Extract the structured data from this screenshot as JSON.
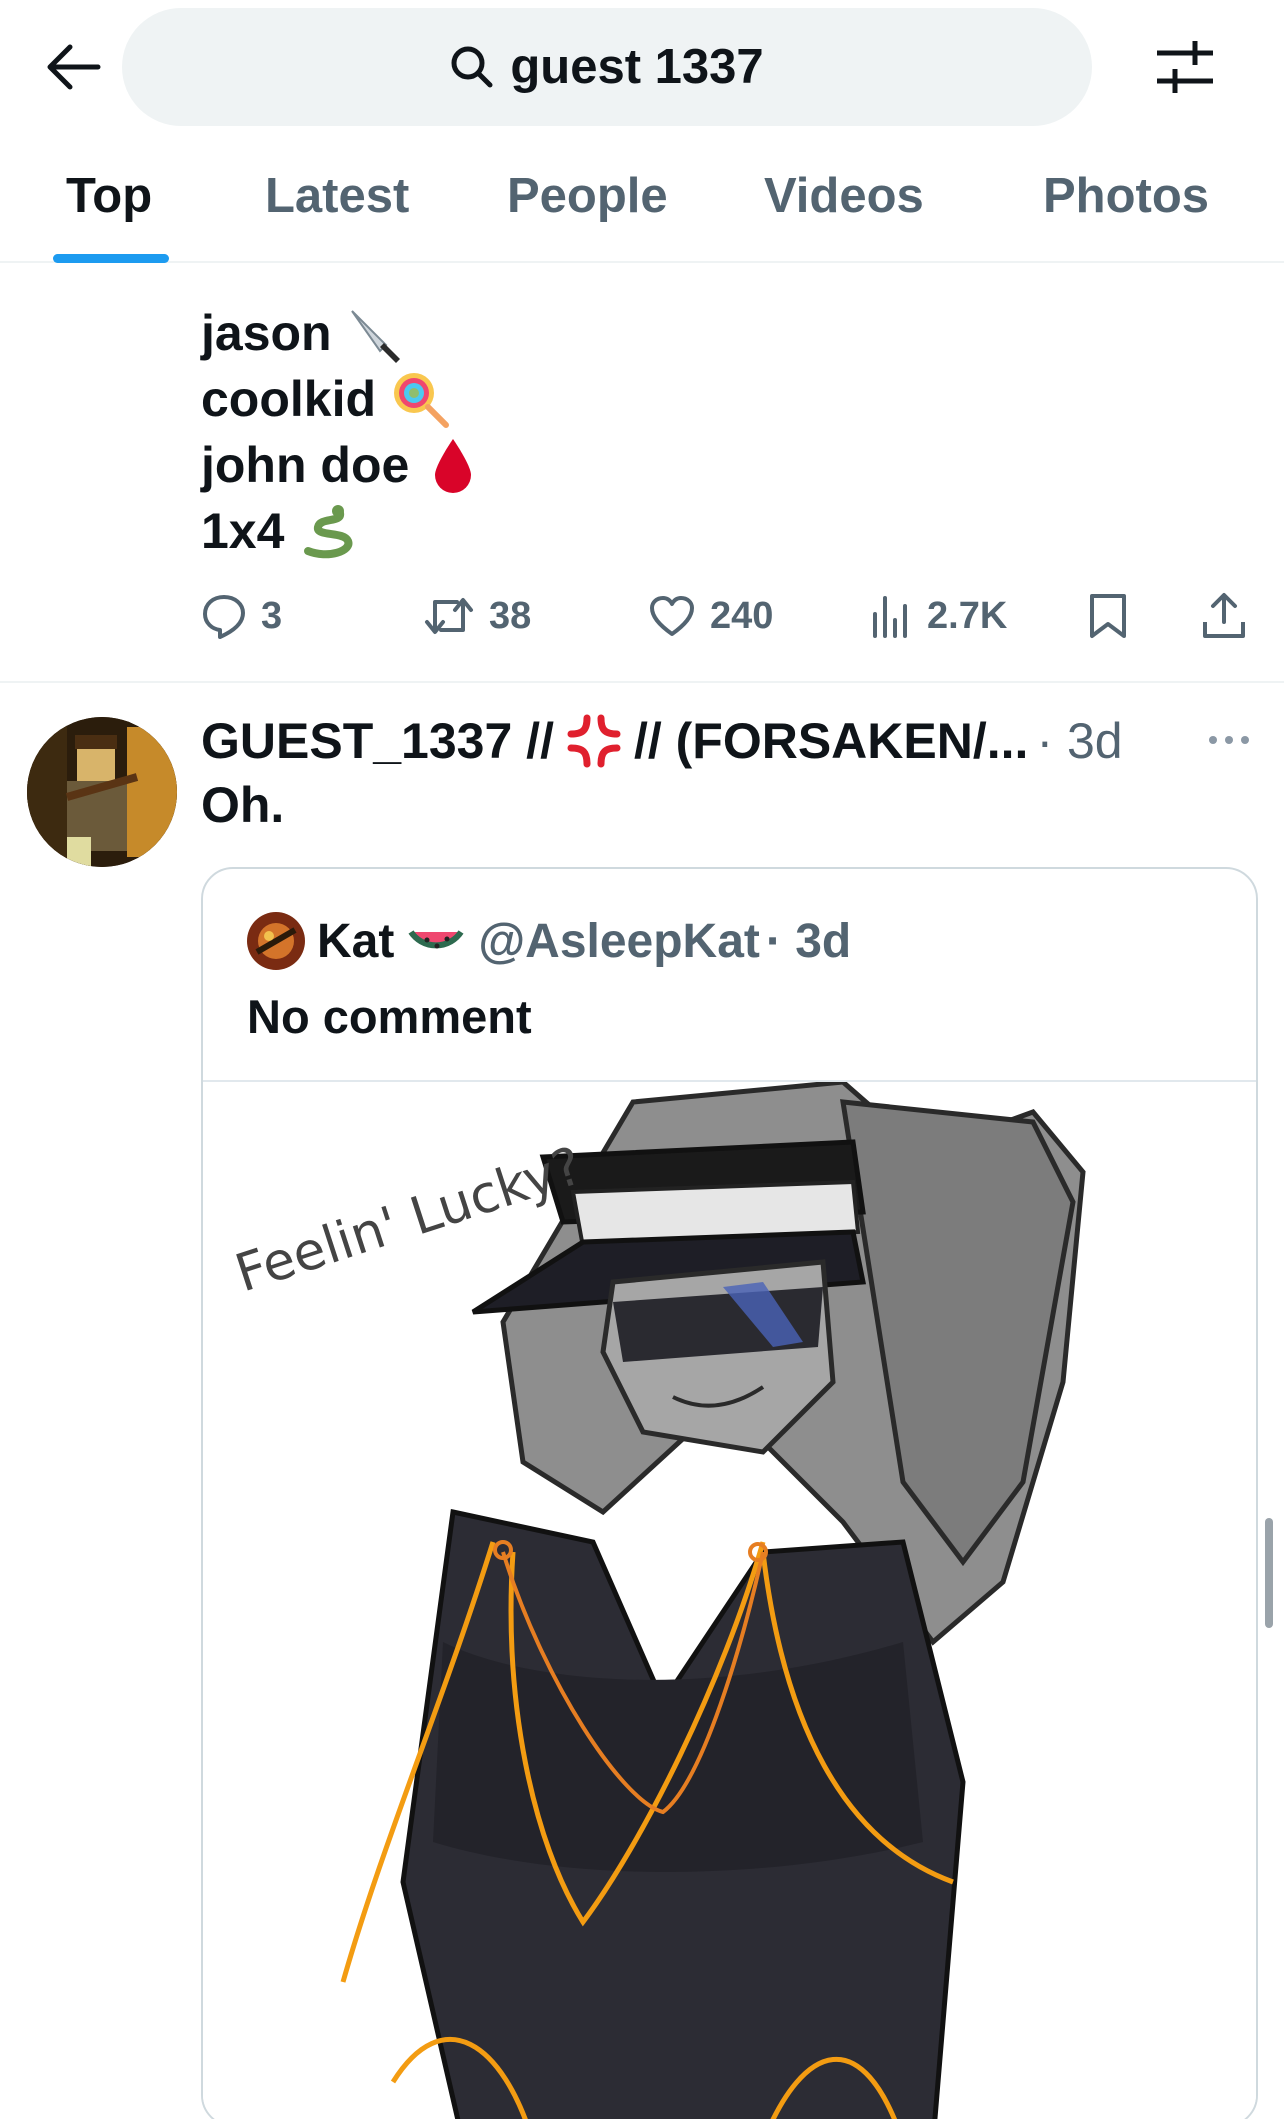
{
  "search": {
    "query": "guest 1337"
  },
  "icons": {
    "back": "arrow-left-icon",
    "search": "search-icon",
    "filter": "sliders-icon",
    "reply": "reply-icon",
    "retweet": "retweet-icon",
    "like": "heart-icon",
    "views": "views-icon",
    "bookmark": "bookmark-icon",
    "share": "share-icon",
    "more": "more-icon"
  },
  "tabs": [
    {
      "label": "Top",
      "active": true
    },
    {
      "label": "Latest"
    },
    {
      "label": "People"
    },
    {
      "label": "Videos"
    },
    {
      "label": "Photos"
    }
  ],
  "tweet1": {
    "lines": [
      {
        "text": "jason",
        "emoji": "knife"
      },
      {
        "text": "coolkid",
        "emoji": "lollipop"
      },
      {
        "text": "john doe",
        "emoji": "drop-of-blood"
      },
      {
        "text": "1x4",
        "emoji": "snake"
      }
    ],
    "stats": {
      "replies": "3",
      "retweets": "38",
      "likes": "240",
      "views": "2.7K"
    }
  },
  "tweet2": {
    "name_prefix": "GUEST_1337 //",
    "name_emoji": "anger-symbol",
    "name_suffix": "// (FORSAKEN/...",
    "time": "· 3d",
    "text": "Oh.",
    "quote": {
      "name": "Kat",
      "name_emoji": "watermelon",
      "handle": "@AsleepKat",
      "time": "· 3d",
      "text": "No comment",
      "media_caption": "Feelin' Lucky?"
    }
  },
  "colors": {
    "accent": "#1d9bf0",
    "text": "#0f1419",
    "secondary": "#536471",
    "border": "#cfd9de"
  }
}
